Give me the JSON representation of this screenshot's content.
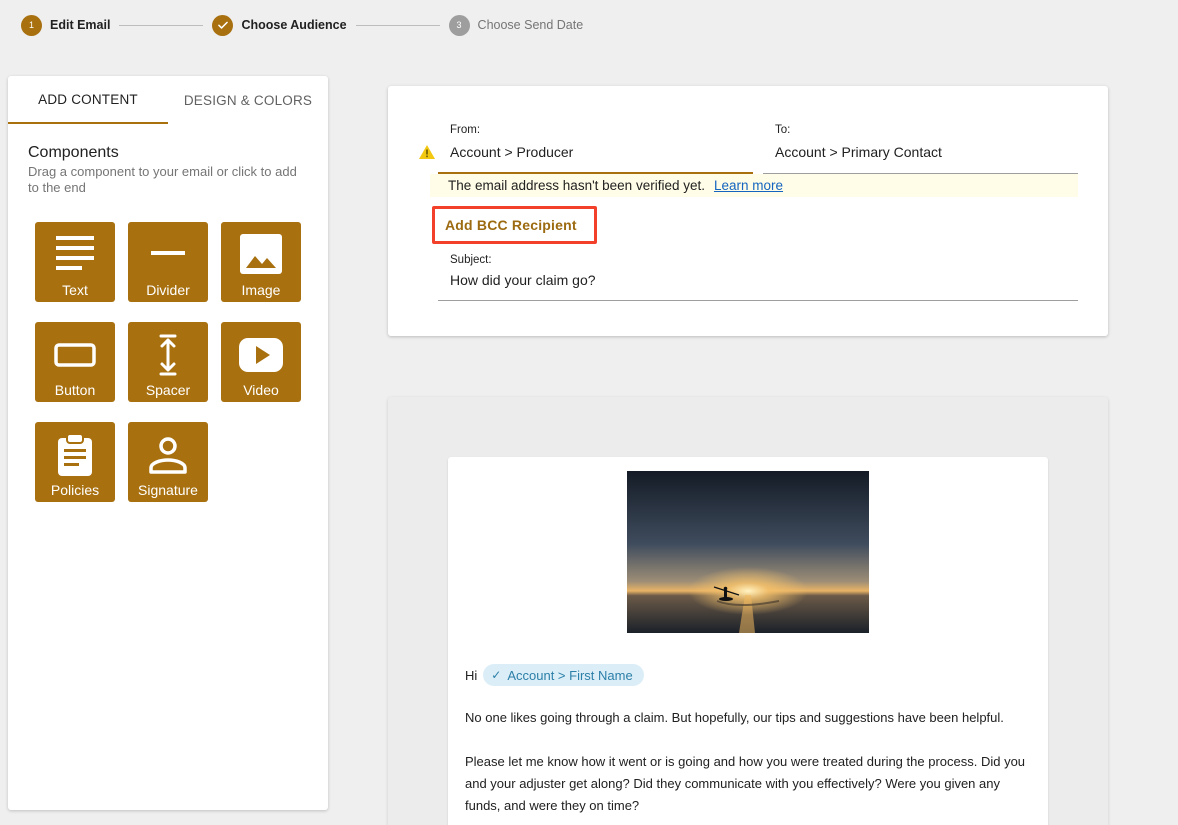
{
  "stepper": {
    "steps": [
      {
        "number": "1",
        "label": "Edit Email",
        "state": "active"
      },
      {
        "number": "",
        "label": "Choose Audience",
        "state": "completed"
      },
      {
        "number": "3",
        "label": "Choose Send Date",
        "state": "pending"
      }
    ]
  },
  "left_panel": {
    "tabs": [
      {
        "label": "ADD CONTENT",
        "active": true
      },
      {
        "label": "DESIGN & COLORS",
        "active": false
      }
    ],
    "components_title": "Components",
    "components_subtitle": "Drag a component to your email or click to add to the end",
    "components": [
      {
        "label": "Text",
        "icon": "text-icon"
      },
      {
        "label": "Divider",
        "icon": "divider-icon"
      },
      {
        "label": "Image",
        "icon": "image-icon"
      },
      {
        "label": "Button",
        "icon": "button-icon"
      },
      {
        "label": "Spacer",
        "icon": "spacer-icon"
      },
      {
        "label": "Video",
        "icon": "video-icon"
      },
      {
        "label": "Policies",
        "icon": "clipboard-icon"
      },
      {
        "label": "Signature",
        "icon": "person-icon"
      }
    ]
  },
  "header": {
    "from_label": "From:",
    "from_value": "Account > Producer",
    "to_label": "To:",
    "to_value": "Account > Primary Contact",
    "warning_text": "The email address hasn't been verified yet.",
    "learn_more": "Learn more",
    "bcc_label": "Add BCC Recipient",
    "subject_label": "Subject:",
    "subject_value": "How did your claim go?"
  },
  "email": {
    "greeting": "Hi",
    "merge_field": "Account > First Name",
    "paragraph1": "No one likes going through a claim. But hopefully, our tips and suggestions have been helpful.",
    "paragraph2": "Please let me know how it went or is going and how you were treated during the process. Did you and your adjuster get along? Did they communicate with you effectively? Were you given any funds, and were they on time?"
  },
  "colors": {
    "accent": "#a8700f",
    "highlight_border": "#f2402b",
    "warning_bg": "#fffde7",
    "chip_bg": "#dbeef8"
  }
}
